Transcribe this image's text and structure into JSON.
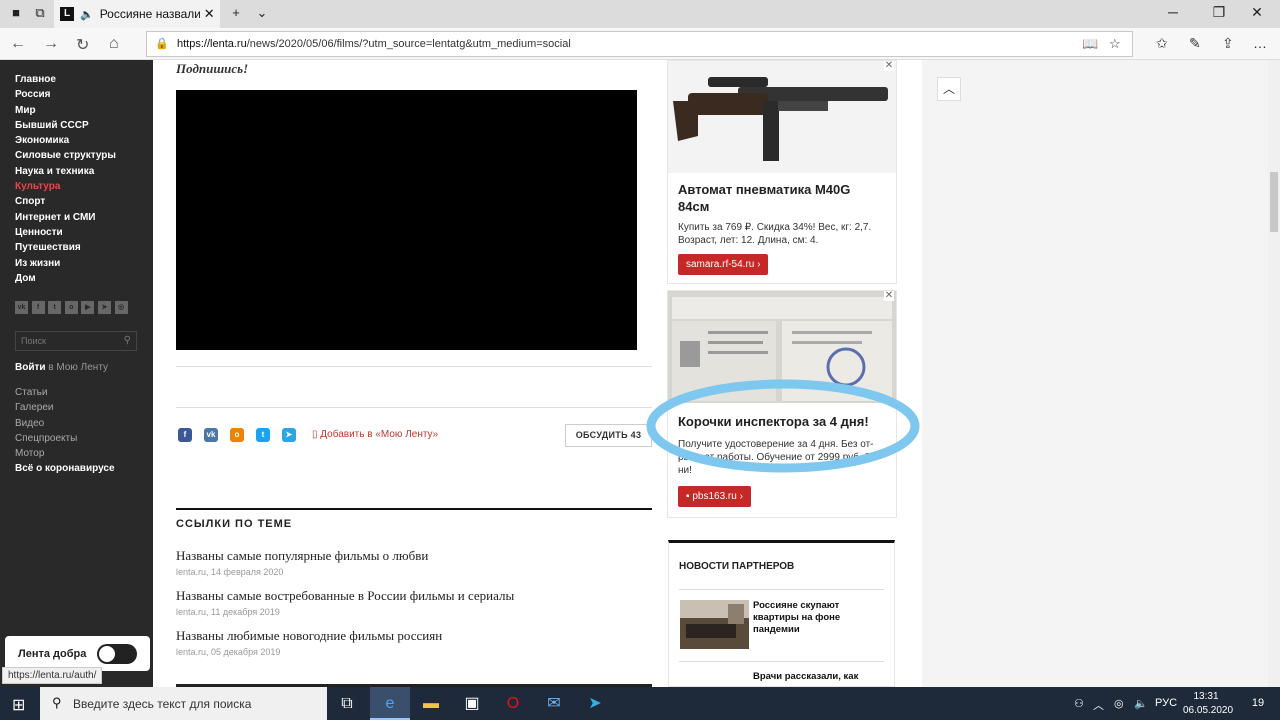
{
  "browser": {
    "tab_title": "Россияне назвали",
    "tab_favicon": "L",
    "url_scheme_host": "https://lenta.ru",
    "url_rest": "/news/2020/05/06/films/?utm_source=lentatg&utm_medium=social"
  },
  "sidebar": {
    "menu": [
      "Главное",
      "Россия",
      "Мир",
      "Бывший СССР",
      "Экономика",
      "Силовые структуры",
      "Наука и техника",
      "Культура",
      "Спорт",
      "Интернет и СМИ",
      "Ценности",
      "Путешествия",
      "Из жизни",
      "Дом"
    ],
    "active_item": "Культура",
    "socials": [
      "vk-icon",
      "facebook-icon",
      "twitter-icon",
      "odnoklassniki-icon",
      "youtube-icon",
      "telegram-icon",
      "instagram-icon"
    ],
    "search_placeholder": "Поиск",
    "login_bold": "Войти",
    "login_rest": " в Мою Ленту",
    "extras": [
      "Статьи",
      "Галереи",
      "Видео",
      "Спецпроекты",
      "Мотор"
    ],
    "corona": "Всё о коронавирусе",
    "lenta_dobra": "Лента добра",
    "status_url": "https://lenta.ru/auth/"
  },
  "article": {
    "subscribe": "Подпишись!",
    "add_to_lenta": "Добавить в «Мою Ленту»",
    "discuss_button": "ОБСУДИТЬ 43",
    "links_heading": "ССЫЛКИ ПО ТЕМЕ",
    "links": [
      {
        "title": "Названы самые популярные фильмы о любви",
        "meta": "lenta.ru, 14 февраля 2020"
      },
      {
        "title": "Названы самые востребованные в России фильмы и сериалы",
        "meta": "lenta.ru, 11 декабря 2019"
      },
      {
        "title": "Названы любимые новогодние фильмы россиян",
        "meta": "lenta.ru, 05 декабря 2019"
      }
    ]
  },
  "ads": [
    {
      "title": "Автомат пневматика M40G 84см",
      "desc": "Купить за 769 ₽. Скидка 34%! Вес, кг: 2,7. Возраст, лет: 12. Длина, см: 4.",
      "button": "samara.rf-54.ru ›"
    },
    {
      "title": "Корочки инспектора за 4 дня!",
      "desc": "Получите удостоверение за 4 дня. Без от-рыва от работы. Обучение от 2999 руб. 2 ни!",
      "button": "pbs163.ru ›"
    }
  ],
  "partners": {
    "heading": "НОВОСТИ ПАРТНЕРОВ",
    "items": [
      {
        "text": "Россияне скупают квартиры на фоне пандемии"
      },
      {
        "text": "Врачи рассказали, как"
      }
    ]
  },
  "taskbar": {
    "search_placeholder": "Введите здесь текст для поиска",
    "lang": "РУС",
    "time": "13:31",
    "date": "06.05.2020",
    "notifications": "19"
  },
  "colors": {
    "accent_red": "#e2494d",
    "sidebar_bg": "#292929",
    "highlight_blue": "#7ec8f0"
  }
}
